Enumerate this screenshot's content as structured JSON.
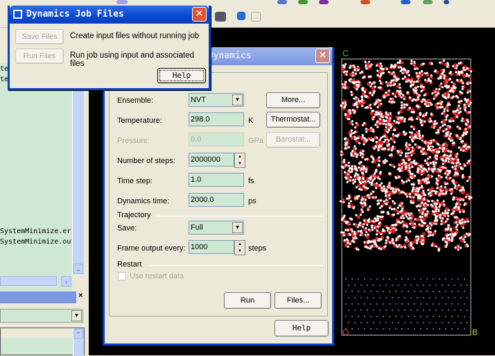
{
  "job_files_dialog": {
    "title": "Dynamics Job Files",
    "close": "✕",
    "save_files": "Save Files",
    "save_files_desc": "Create input files without running job",
    "run_files": "Run Files",
    "run_files_desc": "Run job using input and associated files",
    "help": "Help"
  },
  "dynamics_dialog": {
    "title": "Forcite Molecular Dynamics",
    "close": "✕",
    "ensemble_label": "Ensemble:",
    "ensemble_value": "NVT",
    "more": "More...",
    "temperature_label": "Temperature:",
    "temperature_value": "298.0",
    "temperature_unit": "K",
    "thermostat": "Thermostat...",
    "pressure_label": "Pressure:",
    "pressure_value": "0.0",
    "pressure_unit": "GPa",
    "barostat": "Barostat...",
    "steps_label": "Number of steps:",
    "steps_value": "2000000",
    "timestep_label": "Time step:",
    "timestep_value": "1.0",
    "timestep_unit": "fs",
    "dyntime_label": "Dynamics time:",
    "dyntime_value": "2000.0",
    "dyntime_unit": "ps",
    "trajectory_label": "Trajectory",
    "save_label": "Save:",
    "save_value": "Full",
    "frame_label": "Frame output every:",
    "frame_value": "1000",
    "frame_unit": "steps",
    "restart_label": "Restart",
    "use_restart": "Use restart data",
    "run": "Run",
    "files": "Files...",
    "help": "Help"
  },
  "left_panel": {
    "files": [
      "SystemMinimize.err",
      "SystemMinimize.out"
    ],
    "partial_lines": [
      "ter",
      "ter"
    ],
    "close": "×"
  },
  "viewer": {
    "axis_c": "C",
    "axis_b": "B",
    "axis_o": "O"
  },
  "colors": {
    "oxygen": "#e02020",
    "hydrogen": "#ffffff",
    "substrate": "#8080d0",
    "title_active": "#0a48d4"
  }
}
